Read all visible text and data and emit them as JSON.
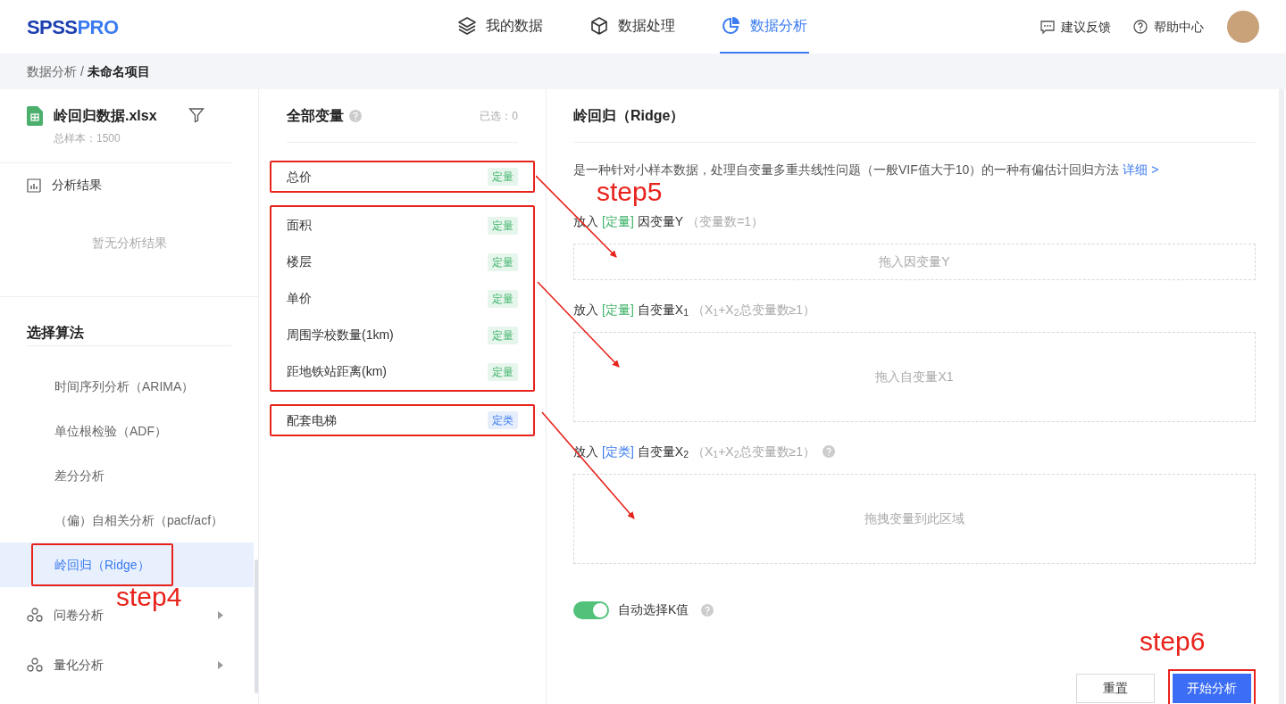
{
  "header": {
    "logo": [
      "SPSS",
      "PRO"
    ],
    "nav": [
      {
        "label": "我的数据",
        "selected": false
      },
      {
        "label": "数据处理",
        "selected": false
      },
      {
        "label": "数据分析",
        "selected": true
      }
    ],
    "links": [
      {
        "label": "建议反馈"
      },
      {
        "label": "帮助中心"
      }
    ]
  },
  "breadcrumb": {
    "items": [
      "数据分析",
      "未命名项目"
    ],
    "separator": "/"
  },
  "file": {
    "name": "岭回归数据.xlsx",
    "sample": "总样本：1500"
  },
  "results": {
    "label": "分析结果",
    "empty": "暂无分析结果"
  },
  "algorithms": {
    "title": "选择算法",
    "items": [
      {
        "label": "时间序列分析（ARIMA）",
        "selected": false,
        "highlighted": false
      },
      {
        "label": "单位根检验（ADF）",
        "selected": false,
        "highlighted": false
      },
      {
        "label": "差分分析",
        "selected": false,
        "highlighted": false
      },
      {
        "label": "（偏）自相关分析（pacf/acf）",
        "selected": false,
        "highlighted": false
      },
      {
        "label": "岭回归（Ridge）",
        "selected": true,
        "highlighted": true
      }
    ],
    "categories": [
      {
        "label": "问卷分析"
      },
      {
        "label": "量化分析"
      }
    ]
  },
  "variables": {
    "title": "全部变量",
    "selected_count": "已选：0",
    "groups": [
      {
        "highlighted": true,
        "items": [
          {
            "name": "总价",
            "tag": "定量",
            "kind": "quantitative"
          }
        ]
      },
      {
        "highlighted": true,
        "items": [
          {
            "name": "面积",
            "tag": "定量",
            "kind": "quantitative"
          },
          {
            "name": "楼层",
            "tag": "定量",
            "kind": "quantitative"
          },
          {
            "name": "单价",
            "tag": "定量",
            "kind": "quantitative"
          },
          {
            "name": "周围学校数量(1km)",
            "tag": "定量",
            "kind": "quantitative"
          },
          {
            "name": "距地铁站距离(km)",
            "tag": "定量",
            "kind": "quantitative"
          }
        ]
      },
      {
        "highlighted": true,
        "items": [
          {
            "name": "配套电梯",
            "tag": "定类",
            "kind": "categorical"
          }
        ]
      }
    ]
  },
  "method": {
    "title": "岭回归（Ridge）",
    "description": "是一种针对小样本数据，处理自变量多重共线性问题（一般VIF值大于10）的一种有偏估计回归方法",
    "detail_link": "详细 >",
    "slots": [
      {
        "prefix": "放入",
        "tag": "[定量]",
        "kind": "quantitative",
        "label": "因变量Y",
        "hint": "（变量数=1）",
        "help": false,
        "drop_text": "拖入因变量Y"
      },
      {
        "prefix": "放入",
        "tag": "[定量]",
        "kind": "quantitative",
        "label": "自变量X$_{1}$",
        "hint": "（X$_{1}$+X$_{2}$总变量数≥1）",
        "help": false,
        "drop_text": "拖入自变量X1"
      },
      {
        "prefix": "放入",
        "tag": "[定类]",
        "kind": "categorical",
        "label": "自变量X$_{2}$",
        "hint": "（X$_{1}$+X$_{2}$总变量数≥1）",
        "help": true,
        "drop_text": "拖拽变量到此区域"
      }
    ],
    "toggle": {
      "label": "自动选择K值",
      "on": true
    },
    "buttons": [
      {
        "label": "重置",
        "kind": "secondary",
        "highlighted": false
      },
      {
        "label": "开始分析",
        "kind": "primary",
        "highlighted": true
      }
    ]
  },
  "annotations": [
    {
      "text": "step5"
    },
    {
      "text": "step4"
    },
    {
      "text": "step6"
    }
  ]
}
